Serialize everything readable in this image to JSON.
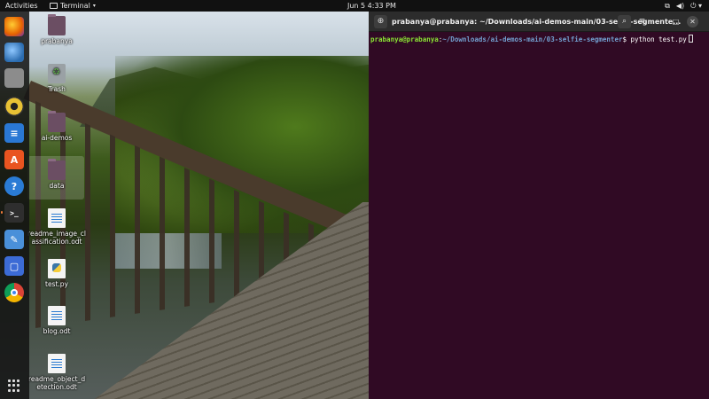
{
  "topbar": {
    "activities": "Activities",
    "app_name": "Terminal",
    "clock": "Jun 5  4:33 PM",
    "tray_icons": [
      "network-icon",
      "volume-icon",
      "power-icon"
    ]
  },
  "dock": {
    "items": [
      {
        "name": "firefox",
        "color": "#e66000"
      },
      {
        "name": "thunderbird",
        "color": "#2b6cb0"
      },
      {
        "name": "files",
        "color": "#8c8c8c"
      },
      {
        "name": "rhythmbox",
        "color": "#e8c234"
      },
      {
        "name": "libreoffice-writer",
        "color": "#2a78d4"
      },
      {
        "name": "ubuntu-software",
        "color": "#e95420"
      },
      {
        "name": "help",
        "color": "#2a7bd5"
      },
      {
        "name": "terminal",
        "color": "#2e2e2e"
      },
      {
        "name": "text-editor",
        "color": "#4a90d9"
      },
      {
        "name": "screenshot",
        "color": "#3c6bd6"
      },
      {
        "name": "chrome",
        "color": "#db4437"
      }
    ]
  },
  "desktop": {
    "icons": [
      {
        "label": "prabanya",
        "kind": "home-folder"
      },
      {
        "label": "Trash",
        "kind": "trash"
      },
      {
        "label": "ai-demos",
        "kind": "folder"
      },
      {
        "label": "data",
        "kind": "folder"
      },
      {
        "label": "readme_image_classification.odt",
        "kind": "document"
      },
      {
        "label": "test.py",
        "kind": "python"
      },
      {
        "label": "blog.odt",
        "kind": "document"
      },
      {
        "label": "readme_object_detection.odt",
        "kind": "document"
      }
    ]
  },
  "terminal": {
    "title": "prabanya@prabanya: ~/Downloads/ai-demos-main/03-selfie-segmente...",
    "prompt_user": "prabanya@prabanya",
    "prompt_sep": ":",
    "prompt_path": "~/Downloads/ai-demos-main/03-selfie-segmenter",
    "prompt_symbol": "$",
    "command": " python test.py",
    "colors": {
      "background": "#300a24",
      "user": "#8ae234",
      "path": "#729fcf"
    }
  }
}
